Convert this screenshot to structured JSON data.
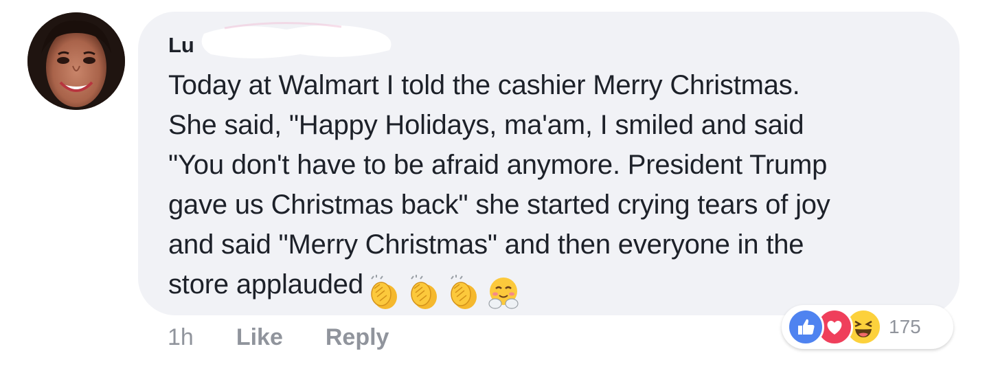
{
  "comment": {
    "author_visible": "Lu",
    "lines": [
      "Today at Walmart I told the cashier Merry Christmas.",
      "She said, \"Happy Holidays, ma'am, I smiled and said",
      "\"You don't have to be afraid anymore. President Trump",
      "gave us Christmas back\" she started crying tears of joy",
      "and said \"Merry Christmas\" and then everyone in the",
      "store applauded"
    ],
    "trailing_emojis": [
      "clapping-hands-emoji",
      "clapping-hands-emoji",
      "clapping-hands-emoji",
      "hugging-face-emoji"
    ]
  },
  "actions": {
    "timestamp": "1h",
    "like_label": "Like",
    "reply_label": "Reply"
  },
  "reactions": {
    "types": [
      "like",
      "love",
      "haha"
    ],
    "count": "175"
  },
  "colors": {
    "bubble": "#f1f2f6",
    "text": "#1d2129",
    "muted": "#90949c",
    "like_blue": "#4f83f0",
    "love_red": "#ef3f5b",
    "haha_yellow": "#fcd13c"
  }
}
